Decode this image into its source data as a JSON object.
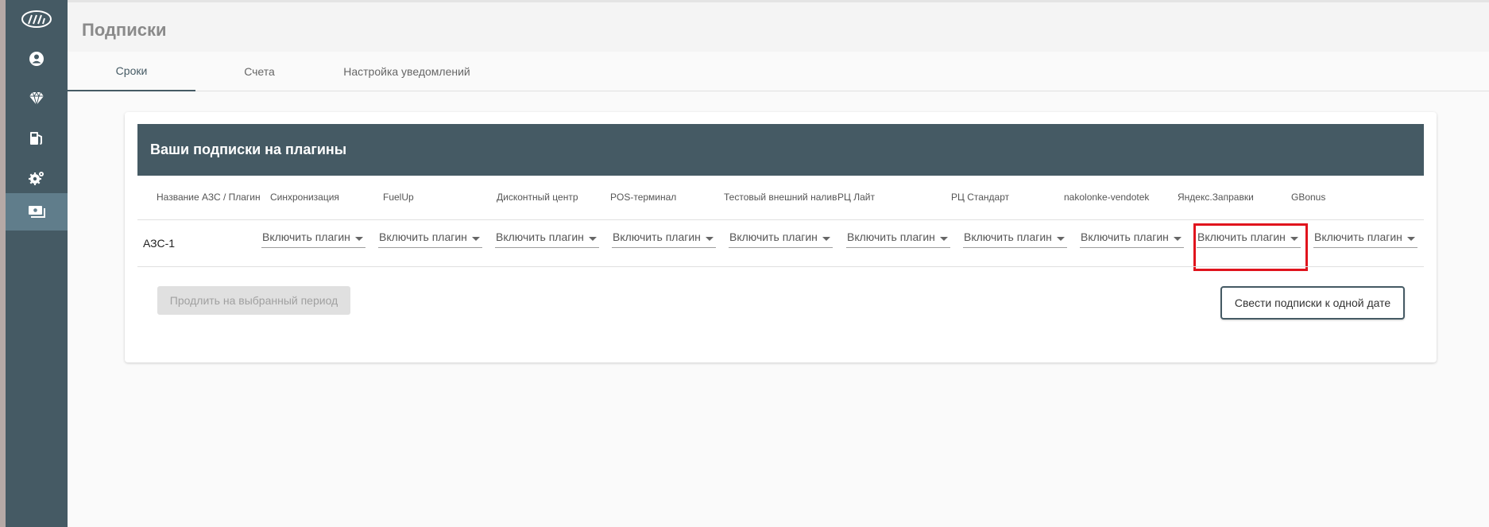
{
  "page": {
    "title": "Подписки"
  },
  "sidebar": {
    "items": [
      {
        "icon": "logo-icon",
        "active": false
      },
      {
        "icon": "user-icon",
        "active": false
      },
      {
        "icon": "diamond-icon",
        "active": false
      },
      {
        "icon": "fuel-pump-icon",
        "active": false
      },
      {
        "icon": "settings-gear-icon",
        "active": false
      },
      {
        "icon": "subscriptions-icon",
        "active": true
      }
    ]
  },
  "tabs": [
    {
      "label": "Сроки",
      "active": true
    },
    {
      "label": "Счета",
      "active": false
    },
    {
      "label": "Настройка уведомлений",
      "active": false
    }
  ],
  "card": {
    "title": "Ваши подписки на плагины",
    "columns": [
      "Название АЗС / Плагин",
      "Синхронизация",
      "FuelUp",
      "Дисконтный центр",
      "POS-терминал",
      "Тестовый внешний налив",
      "РЦ Лайт",
      "РЦ Стандарт",
      "nakolonke-vendotek",
      "Яндекс.Заправки",
      "GBonus"
    ],
    "rows": [
      {
        "station": "АЗС-1",
        "plugins": [
          "Включить плагин",
          "Включить плагин",
          "Включить плагин",
          "Включить плагин",
          "Включить плагин",
          "Включить плагин",
          "Включить плагин",
          "Включить плагин",
          "Включить плагин",
          "Включить плагин"
        ]
      }
    ],
    "extend_button": "Продлить на выбранный период",
    "align_button": "Свести подписки к одной дате"
  },
  "colors": {
    "sidebar": "#455a64",
    "sidebar_active": "#607d8b",
    "highlight": "#e0141d"
  }
}
